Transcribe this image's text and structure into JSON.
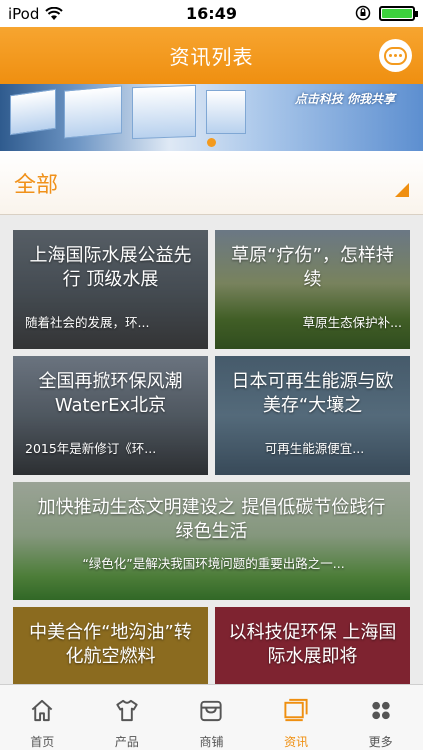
{
  "status": {
    "carrier": "iPod",
    "time": "16:49"
  },
  "nav": {
    "title": "资讯列表",
    "chat_icon": "chat-bubble-icon"
  },
  "banner": {
    "slogan": "点击科技 你我共享",
    "dot_count": 1,
    "active_dot": 0
  },
  "category": {
    "selected": "全部"
  },
  "news": [
    {
      "title": "上海国际水展公益先行 顶级水展",
      "excerpt": "随着社会的发展，环..."
    },
    {
      "title": "草原“疗伤”，怎样持续",
      "excerpt": "草原生态保护补..."
    },
    {
      "title": "全国再掀环保风潮 WaterEx北京",
      "excerpt": "2015年是新修订《环..."
    },
    {
      "title": "日本可再生能源与欧美存“大壤之",
      "excerpt": "可再生能源便宜..."
    },
    {
      "title": "加快推动生态文明建设之 提倡低碳节俭践行绿色生活",
      "excerpt": "“绿色化”是解决我国环境问题的重要出路之一..."
    },
    {
      "title": "中美合作“地沟油”转化航空燃料",
      "excerpt": ""
    },
    {
      "title": "以科技促环保 上海国际水展即将",
      "excerpt": ""
    }
  ],
  "tabs": [
    {
      "label": "首页",
      "icon": "home-icon"
    },
    {
      "label": "产品",
      "icon": "shirt-icon"
    },
    {
      "label": "商铺",
      "icon": "store-icon"
    },
    {
      "label": "资讯",
      "icon": "news-icon",
      "active": true
    },
    {
      "label": "更多",
      "icon": "more-icon"
    }
  ],
  "colors": {
    "accent": "#ef8f10",
    "nav_bg": "#f39a1e"
  }
}
